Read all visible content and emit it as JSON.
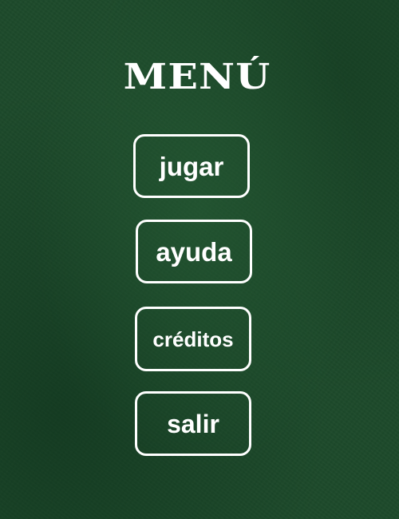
{
  "title": "MENÚ",
  "buttons": {
    "play": "jugar",
    "help": "ayuda",
    "credits": "créditos",
    "exit": "salir"
  },
  "colors": {
    "background": "#1d4a2b",
    "foreground": "#ffffff"
  }
}
